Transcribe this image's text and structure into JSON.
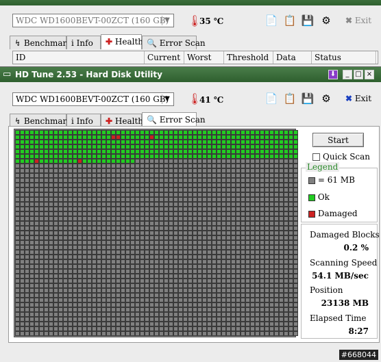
{
  "back_window": {
    "drive": "WDC WD1600BEVT-00ZCT (160 GB)",
    "temperature": "35",
    "temp_unit": "℃",
    "exit_label": "Exit",
    "tabs": [
      {
        "label": "Benchmark",
        "active": false
      },
      {
        "label": "Info",
        "active": false
      },
      {
        "label": "Health",
        "active": true
      },
      {
        "label": "Error Scan",
        "active": false
      }
    ],
    "columns": [
      "ID",
      "Current",
      "Worst",
      "Threshold",
      "Data",
      "Status"
    ]
  },
  "window": {
    "title": "HD Tune 2.53 - Hard Disk Utility",
    "drive": "WDC WD1600BEVT-00ZCT (160 GB)",
    "temperature": "41",
    "temp_unit": "℃",
    "exit_label": "Exit",
    "tabs": [
      {
        "label": "Benchmark",
        "active": false
      },
      {
        "label": "Info",
        "active": false
      },
      {
        "label": "Health",
        "active": false
      },
      {
        "label": "Error Scan",
        "active": true
      }
    ],
    "start_label": "Start",
    "quick_scan_label": "Quick Scan",
    "quick_scan_checked": false,
    "legend": {
      "title": "Legend",
      "block_size": "= 61 MB",
      "ok": "Ok",
      "damaged": "Damaged"
    },
    "stats": {
      "damaged_blocks_label": "Damaged Blocks",
      "damaged_blocks_value": "0.2 %",
      "scanning_speed_label": "Scanning Speed",
      "scanning_speed_value": "54.1 MB/sec",
      "position_label": "Position",
      "position_value": "23138 MB",
      "elapsed_label": "Elapsed Time",
      "elapsed_value": "8:27"
    },
    "scan_map": {
      "columns": 59,
      "rows": 43,
      "scanned_blocks": 379,
      "damaged_blocks": [
        {
          "row": 1,
          "col": 20
        },
        {
          "row": 1,
          "col": 21
        },
        {
          "row": 1,
          "col": 28
        },
        {
          "row": 6,
          "col": 4
        },
        {
          "row": 6,
          "col": 13
        }
      ]
    }
  },
  "colors": {
    "ok": "#22cc22",
    "damaged": "#cc2222",
    "unscanned": "#808080",
    "legend_title": "#2a8a2a",
    "title_bar": "#3a6e3a"
  },
  "watermark": "#668044"
}
